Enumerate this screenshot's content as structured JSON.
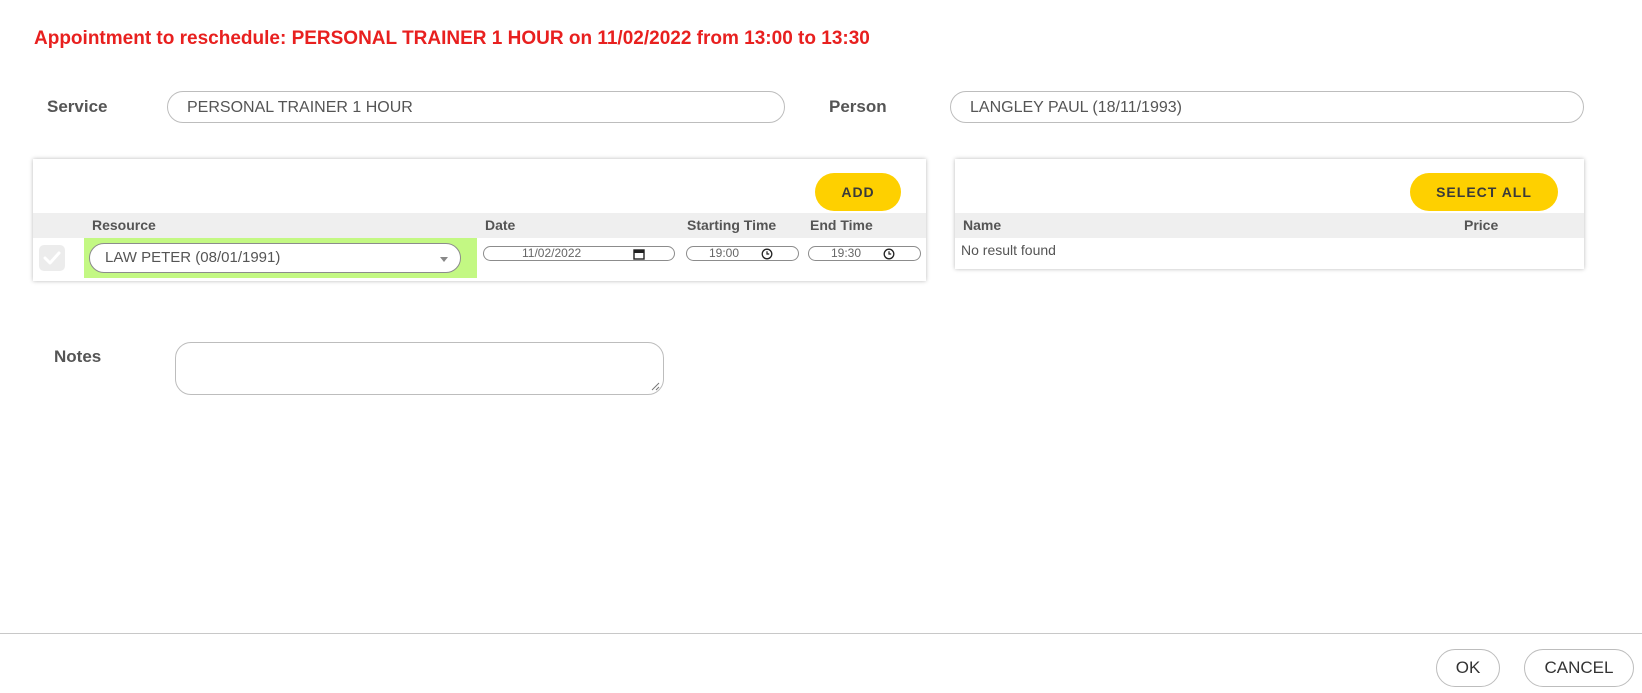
{
  "header": {
    "title": "Appointment to reschedule: PERSONAL TRAINER 1 HOUR on 11/02/2022 from 13:00 to 13:30"
  },
  "service": {
    "label": "Service",
    "value": "PERSONAL TRAINER 1 HOUR"
  },
  "person": {
    "label": "Person",
    "value": "LANGLEY PAUL (18/11/1993)"
  },
  "resources_panel": {
    "add_label": "ADD",
    "columns": {
      "resource": "Resource",
      "date": "Date",
      "start": "Starting Time",
      "end": "End Time"
    },
    "rows": [
      {
        "checked": true,
        "resource": "LAW PETER (08/01/1991)",
        "date": "11/02/2022",
        "start": "19:00",
        "end": "19:30"
      }
    ]
  },
  "items_panel": {
    "select_all_label": "SELECT ALL",
    "columns": {
      "name": "Name",
      "price": "Price"
    },
    "empty_text": "No result found"
  },
  "notes": {
    "label": "Notes",
    "value": ""
  },
  "footer": {
    "ok_label": "OK",
    "cancel_label": "CANCEL"
  },
  "colors": {
    "title": "#e8201f",
    "accent_button": "#fed000",
    "resource_cell": "#c3f883",
    "table_header": "#efefef"
  },
  "icons": {
    "date": "calendar-icon",
    "time": "clock-icon",
    "select": "chevron-down-icon",
    "checkbox": "checkmark-icon",
    "notes": "resize-grip-icon"
  }
}
